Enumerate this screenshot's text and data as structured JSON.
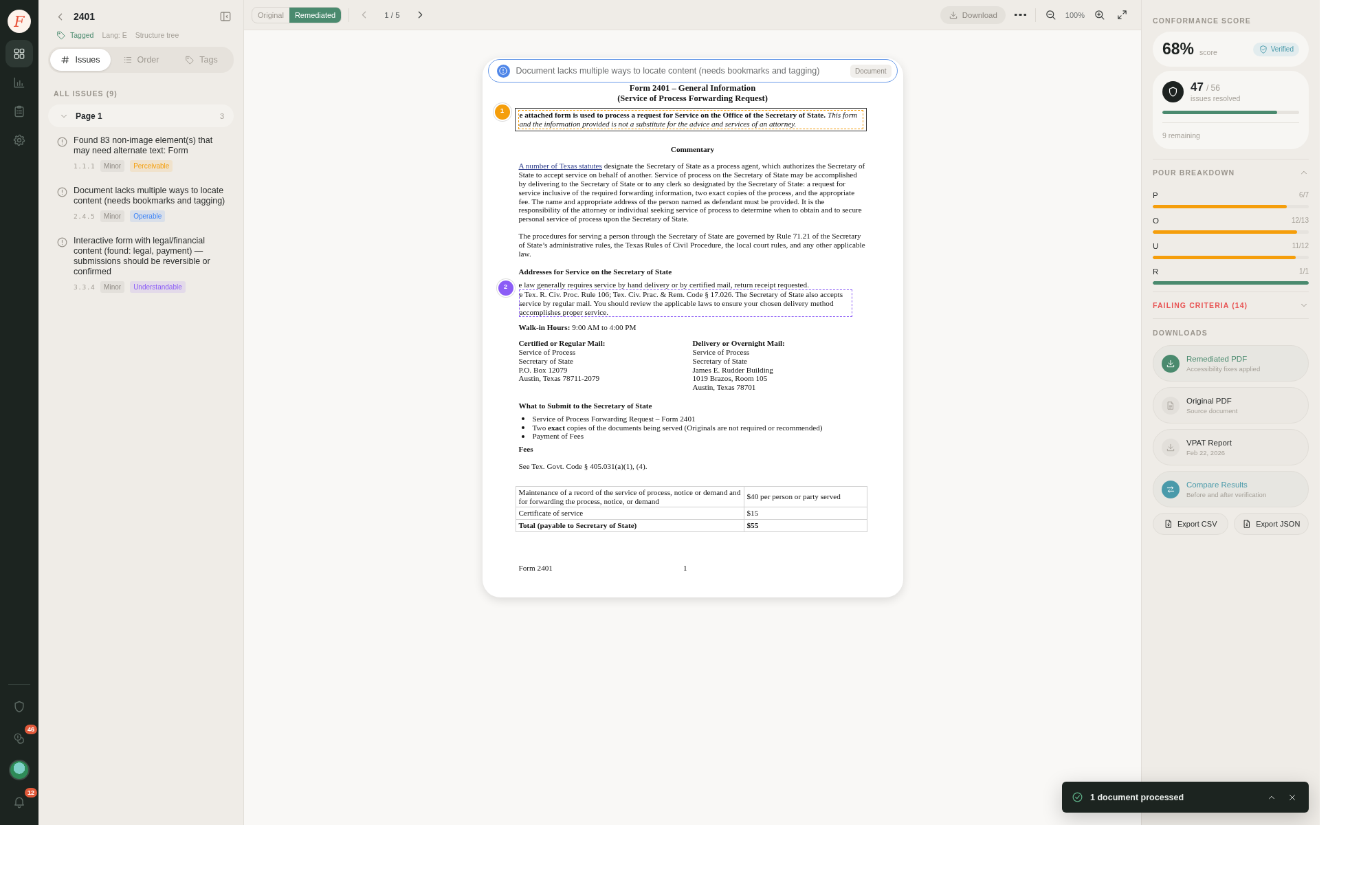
{
  "rail": {
    "logo": "F",
    "items": [
      {
        "kind": "grid",
        "selected": true
      },
      {
        "kind": "chart",
        "selected": false
      },
      {
        "kind": "clipboard",
        "selected": false
      },
      {
        "kind": "gear",
        "selected": false
      }
    ],
    "bottom": [
      {
        "kind": "shield"
      },
      {
        "kind": "coins",
        "badge": "46"
      },
      {
        "kind": "avatar"
      },
      {
        "kind": "bell",
        "badge": "12"
      }
    ]
  },
  "issues_panel": {
    "title": "2401",
    "meta": [
      {
        "kind": "tagged",
        "text": "Tagged"
      },
      {
        "kind": "plain",
        "text": "Lang: E"
      },
      {
        "kind": "plain",
        "text": "Structure tree"
      }
    ],
    "tabs": [
      {
        "kind": "hash",
        "label": "Issues",
        "selected": true
      },
      {
        "kind": "list",
        "label": "Order",
        "selected": false
      },
      {
        "kind": "tag",
        "label": "Tags",
        "selected": false
      }
    ],
    "heading": "ALL ISSUES (9)",
    "groups": [
      {
        "label": "Page 1",
        "count": "3",
        "expanded": true,
        "items": [
          {
            "text": "Found 83 non-image element(s) that may need alternate text: Form",
            "code": "1.1.1",
            "severity": "Minor",
            "category": "Perceivable",
            "color": "#f59e0b"
          },
          {
            "text": "Document lacks multiple ways to locate content (needs bookmarks and tagging)",
            "code": "2.4.5",
            "severity": "Minor",
            "category": "Operable",
            "color": "#3b82f6"
          },
          {
            "text": "Interactive form with legal/financial content (found: legal, payment) — submissions should be reversible or confirmed",
            "code": "3.3.4",
            "severity": "Minor",
            "category": "Understandable",
            "color": "#8b5cf6"
          }
        ]
      }
    ]
  },
  "toolbar": {
    "views": [
      {
        "label": "Original",
        "selected": false
      },
      {
        "label": "Remediated",
        "selected": true
      }
    ],
    "pager": {
      "text": "1 / 5",
      "prev_disabled": true,
      "next_disabled": false
    },
    "download": "Download",
    "zoom": "100%"
  },
  "banner": {
    "text": "Document lacks multiple ways to locate content (needs bookmarks and tagging)",
    "tag": "Document"
  },
  "document": {
    "blocks": [
      {
        "kind": "title",
        "lines": [
          "Form 2401 – General Information",
          "(Service of Process Forwarding Request)"
        ]
      },
      {
        "kind": "boxed",
        "marker": "1",
        "color": "#f59e0b",
        "text": "**e attached form is used to process a request for Service on the Office of the Secretary of State.** *This form and the information provided is not a substitute for the advice and services of an attorney.*"
      },
      {
        "kind": "heading_center",
        "text": "Commentary"
      },
      {
        "kind": "para_link",
        "link": "A number of Texas statutes",
        "text": " designate the Secretary of State as a process agent, which authorizes the Secretary of State to accept service on behalf of another. Service of process on the Secretary of State may be accomplished by delivering to the Secretary of State or to any clerk so designated by the Secretary of State: a request for service inclusive of the required forwarding information, two exact copies of the process, and the appropriate fee. The name and appropriate address of the person named as defendant must be provided. It is the responsibility of the attorney or individual seeking service of process to determine when to obtain and to secure personal service of process upon the Secretary of State."
      },
      {
        "kind": "para",
        "text": "The procedures for serving a person through the Secretary of State are governed by Rule 71.21 of the Secretary of State’s administrative rules, the Texas Rules of Civil Procedure, the local court rules, and any other applicable law."
      },
      {
        "kind": "heading",
        "text": "Addresses for Service on the Secretary of State"
      },
      {
        "kind": "flagged",
        "marker": "2",
        "color": "#8b5cf6",
        "lead": "e law generally requires service by hand delivery or by certified mail, return receipt requested.",
        "text": "e Tex. R. Civ. Proc. Rule 106; Tex. Civ. Prac. & Rem. Code § 17.026.  The Secretary of State also accepts service by regular mail.  You should review the applicable laws to ensure your chosen delivery method accomplishes proper service."
      },
      {
        "kind": "para",
        "text": "**Walk-in Hours:** 9:00 AM to 4:00 PM"
      },
      {
        "kind": "columns",
        "columns": [
          {
            "heading": "Certified or Regular Mail:",
            "lines": [
              "Service of Process",
              "Secretary of State",
              "P.O. Box 12079",
              "Austin, Texas 78711-2079"
            ]
          },
          {
            "heading": "Delivery or Overnight Mail:",
            "lines": [
              "Service of Process",
              "Secretary of State",
              "James E. Rudder Building",
              "1019 Brazos, Room 105",
              "Austin, Texas 78701"
            ]
          }
        ]
      },
      {
        "kind": "heading",
        "text": "What to Submit to the Secretary of State"
      },
      {
        "kind": "bullets",
        "items": [
          "Service of Process Forwarding Request – Form 2401",
          "Two **exact** copies of the documents being served (Originals are not required or recommended)",
          "Payment of Fees"
        ]
      },
      {
        "kind": "heading",
        "text": "Fees"
      },
      {
        "kind": "para",
        "text": "See Tex. Govt. Code § 405.031(a)(1), (4)."
      },
      {
        "kind": "table",
        "rows": [
          {
            "bold": false,
            "cells": [
              "Maintenance of a record of the service of process, notice or demand and for forwarding the process, notice, or demand",
              "$40 per person or party served"
            ]
          },
          {
            "bold": false,
            "cells": [
              "Certificate of service",
              "$15"
            ]
          },
          {
            "bold": true,
            "cells": [
              "Total (payable to Secretary of State)",
              "$55"
            ]
          }
        ]
      },
      {
        "kind": "footer",
        "left": "Form 2401",
        "center": "1"
      }
    ]
  },
  "score_panel": {
    "heading": "CONFORMANCE SCORE",
    "score": "68%",
    "score_label": "score",
    "verified": "Verified",
    "resolved": {
      "count": "47",
      "total": "/ 56",
      "label": "issues resolved",
      "level": 0.84,
      "remaining": "9 remaining"
    },
    "pour": {
      "heading": "POUR BREAKDOWN",
      "expanded": true,
      "items": [
        {
          "letter": "P",
          "value": "6/7",
          "level": 0.857,
          "color": "#f59e0b"
        },
        {
          "letter": "O",
          "value": "12/13",
          "level": 0.923,
          "color": "#f59e0b"
        },
        {
          "letter": "U",
          "value": "11/12",
          "level": 0.917,
          "color": "#f59e0b"
        },
        {
          "letter": "R",
          "value": "1/1",
          "level": 1,
          "color": "#4a8a6e"
        }
      ]
    },
    "failing": {
      "text": "FAILING CRITERIA (14)",
      "expanded": false
    },
    "downloads": {
      "heading": "DOWNLOADS",
      "items": [
        {
          "kind": "primary",
          "title": "Remediated PDF",
          "subtitle": "Accessibility fixes applied"
        },
        {
          "kind": "file",
          "title": "Original PDF",
          "subtitle": "Source document"
        },
        {
          "kind": "report",
          "title": "VPAT Report",
          "subtitle": "Feb 22, 2026"
        },
        {
          "kind": "compare",
          "title": "Compare Results",
          "subtitle": "Before and after verification"
        }
      ],
      "exports": [
        "Export CSV",
        "Export JSON"
      ]
    }
  },
  "toast": {
    "text": "1 document processed"
  }
}
